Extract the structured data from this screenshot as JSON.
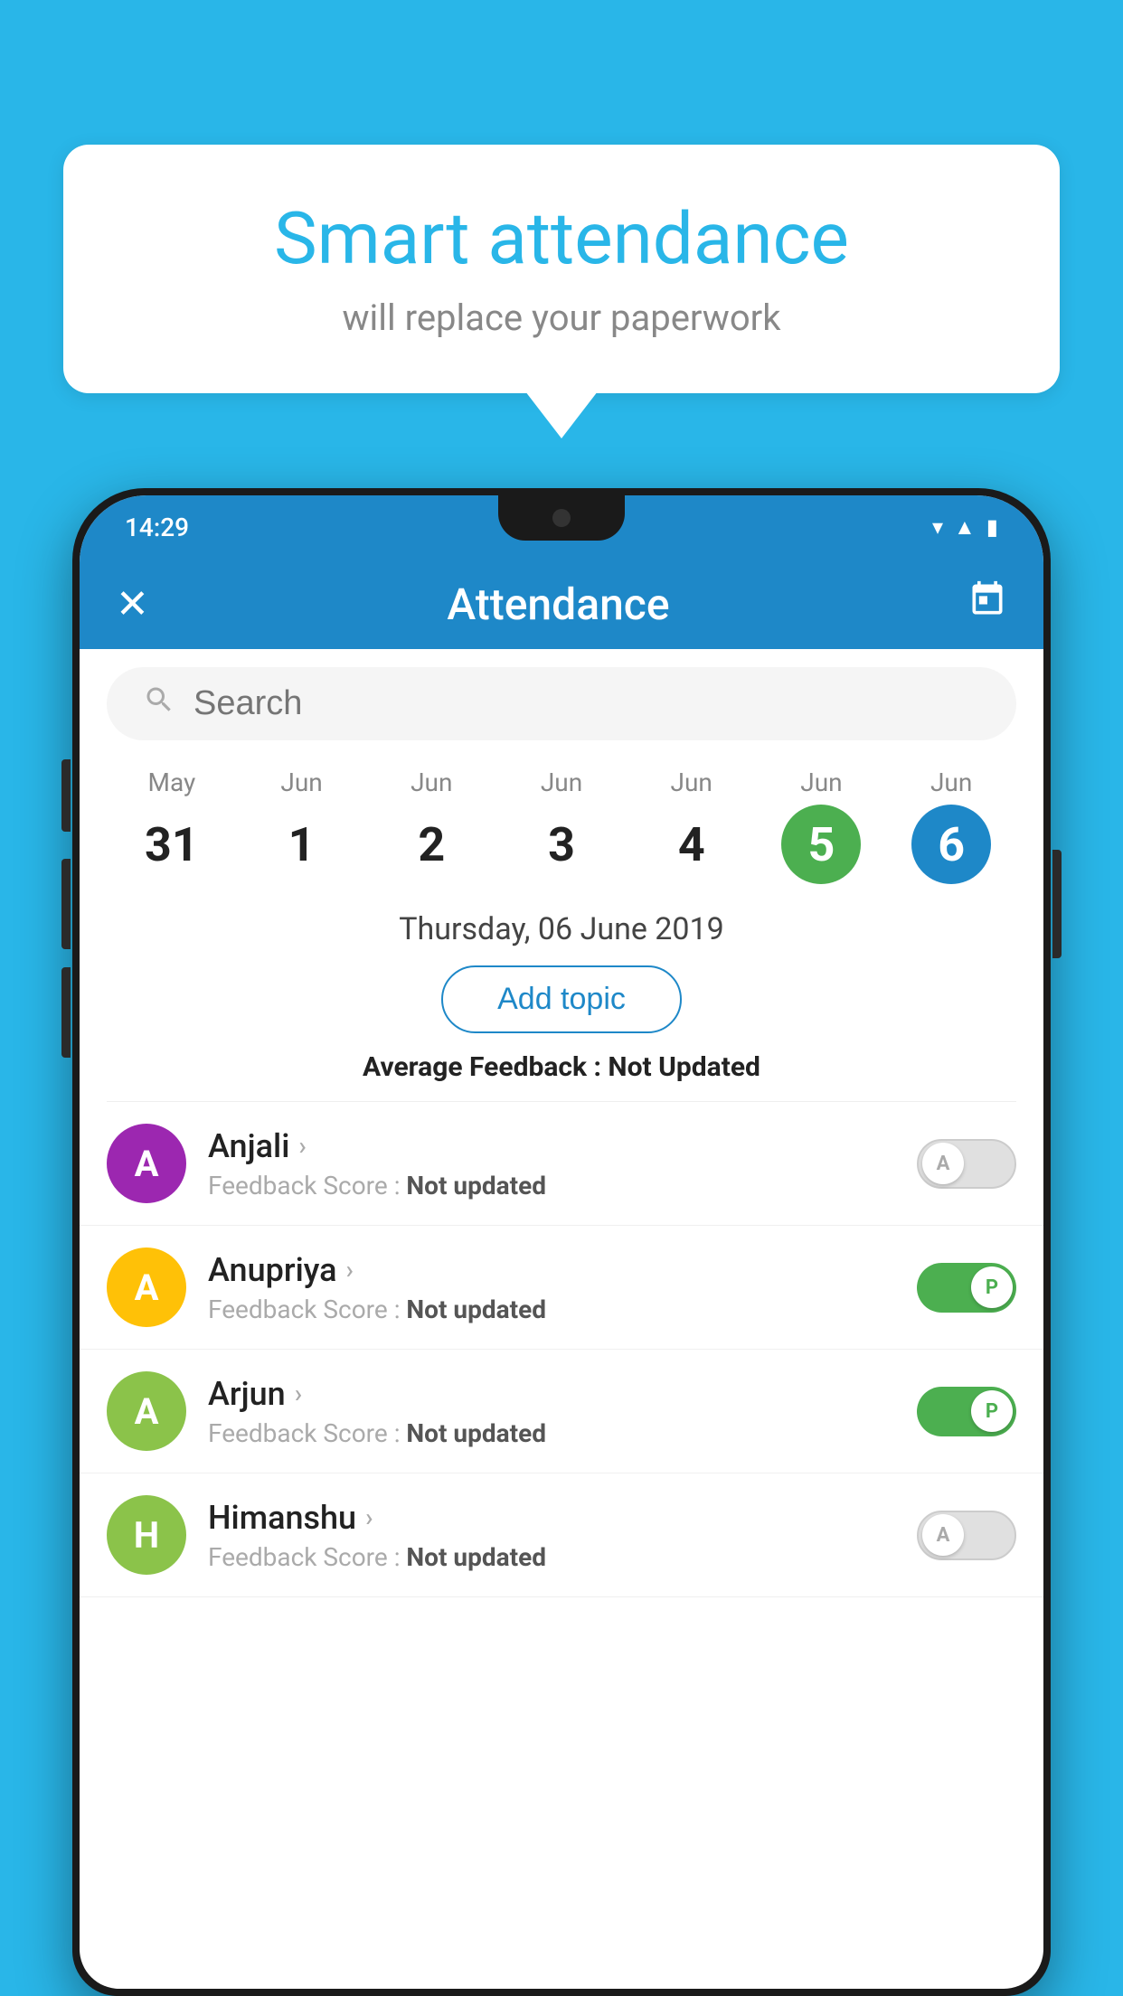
{
  "background_color": "#29b6e8",
  "speech_bubble": {
    "title": "Smart attendance",
    "subtitle": "will replace your paperwork"
  },
  "status_bar": {
    "time": "14:29",
    "icons": [
      "wifi",
      "signal",
      "battery"
    ]
  },
  "app_bar": {
    "title": "Attendance",
    "close_icon": "✕",
    "calendar_icon": "📅"
  },
  "search": {
    "placeholder": "Search"
  },
  "dates": [
    {
      "month": "May",
      "day": "31",
      "state": "normal"
    },
    {
      "month": "Jun",
      "day": "1",
      "state": "normal"
    },
    {
      "month": "Jun",
      "day": "2",
      "state": "normal"
    },
    {
      "month": "Jun",
      "day": "3",
      "state": "normal"
    },
    {
      "month": "Jun",
      "day": "4",
      "state": "normal"
    },
    {
      "month": "Jun",
      "day": "5",
      "state": "today"
    },
    {
      "month": "Jun",
      "day": "6",
      "state": "selected"
    }
  ],
  "selected_date_label": "Thursday, 06 June 2019",
  "add_topic_label": "Add topic",
  "avg_feedback_label": "Average Feedback :",
  "avg_feedback_value": "Not Updated",
  "students": [
    {
      "name": "Anjali",
      "avatar_letter": "A",
      "avatar_color": "#9c27b0",
      "feedback_label": "Feedback Score :",
      "feedback_value": "Not updated",
      "toggle_state": "off",
      "toggle_label": "A"
    },
    {
      "name": "Anupriya",
      "avatar_letter": "A",
      "avatar_color": "#ffc107",
      "feedback_label": "Feedback Score :",
      "feedback_value": "Not updated",
      "toggle_state": "on",
      "toggle_label": "P"
    },
    {
      "name": "Arjun",
      "avatar_letter": "A",
      "avatar_color": "#8bc34a",
      "feedback_label": "Feedback Score :",
      "feedback_value": "Not updated",
      "toggle_state": "on",
      "toggle_label": "P"
    },
    {
      "name": "Himanshu",
      "avatar_letter": "H",
      "avatar_color": "#8bc34a",
      "feedback_label": "Feedback Score :",
      "feedback_value": "Not updated",
      "toggle_state": "off",
      "toggle_label": "A"
    }
  ]
}
